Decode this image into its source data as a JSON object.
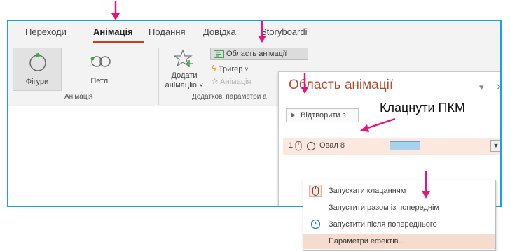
{
  "ribbon": {
    "tabs": [
      "Переходи",
      "Анімація",
      "Подання",
      "Довідка",
      "Storyboardi"
    ],
    "active_tab": "Анімація"
  },
  "animation_group": {
    "shapes_label": "Фігури",
    "loops_label": "Петлі",
    "group_label": "Анімація"
  },
  "advanced_group": {
    "add_animation_label_1": "Додати",
    "add_animation_label_2": "анімацію",
    "animation_pane_button": "Область анімації",
    "trigger_button": "Тригер",
    "painter_button": "Анімація",
    "group_label": "Додаткові параметри а"
  },
  "pane": {
    "title": "Область анімації",
    "play_button": "Відтворити з",
    "item_number": "1",
    "item_name": "Овал 8"
  },
  "callout": {
    "text": "Клацнути ПКМ"
  },
  "context_menu": {
    "items": [
      "Запускати клацанням",
      "Запустити разом із попереднім",
      "Запустити після попереднього",
      "Параметри ефектів..."
    ]
  },
  "colors": {
    "frame": "#19a3dd",
    "arrow": "#e5157a",
    "accent": "#c43e1c",
    "selected_row": "#fde8df",
    "timing_bar": "#a8d1ee"
  }
}
